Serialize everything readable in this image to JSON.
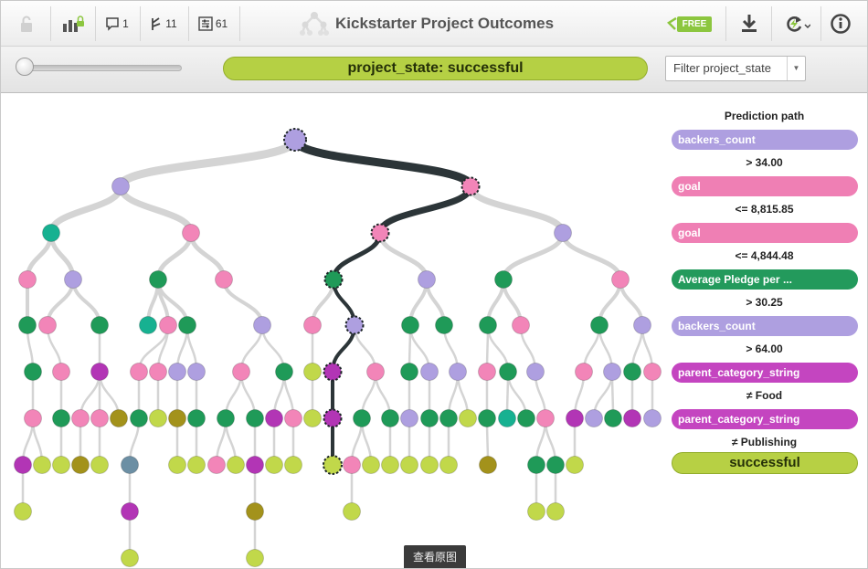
{
  "app": {
    "title": "Kickstarter Project Outcomes",
    "free_badge": "FREE"
  },
  "toolbar": {
    "comments_count": "1",
    "fields_count": "11",
    "instances_count": "61",
    "icons": [
      "lock-icon",
      "chart-lock-icon",
      "comment-icon",
      "fork-icon",
      "sliders-icon",
      "free-tag-icon",
      "download-icon",
      "refresh-icon",
      "info-icon"
    ]
  },
  "controls": {
    "state_label": "project_state: successful",
    "filter_label": "Filter project_state"
  },
  "prediction_path": {
    "title": "Prediction path",
    "steps": [
      {
        "field": "backers_count",
        "color": "#ae9fe0"
      },
      {
        "condition": "> 34.00"
      },
      {
        "field": "goal",
        "color": "#ef7fb4"
      },
      {
        "condition": "<= 8,815.85"
      },
      {
        "field": "goal",
        "color": "#ef7fb4"
      },
      {
        "condition": "<= 4,844.48"
      },
      {
        "field": "Average Pledge per ...",
        "color": "#239a5c"
      },
      {
        "condition": "> 30.25"
      },
      {
        "field": "backers_count",
        "color": "#ae9fe0"
      },
      {
        "condition": "> 64.00"
      },
      {
        "field": "parent_category_string",
        "color": "#c445c0"
      },
      {
        "condition": "≠ Food"
      },
      {
        "field": "parent_category_string",
        "color": "#c445c0"
      },
      {
        "condition": "≠ Publishing"
      }
    ],
    "result": "successful"
  },
  "colors": {
    "path_line": "#2c3538",
    "branch_line": "#d4d4d4",
    "lavender": "#ae9fe0",
    "pink": "#f285b8",
    "green": "#1f9a58",
    "teal": "#17b191",
    "magenta": "#b235b5",
    "lime": "#c1d84a",
    "olive": "#a3921b",
    "slate": "#6c8fa4"
  },
  "watermark": "查看原图"
}
